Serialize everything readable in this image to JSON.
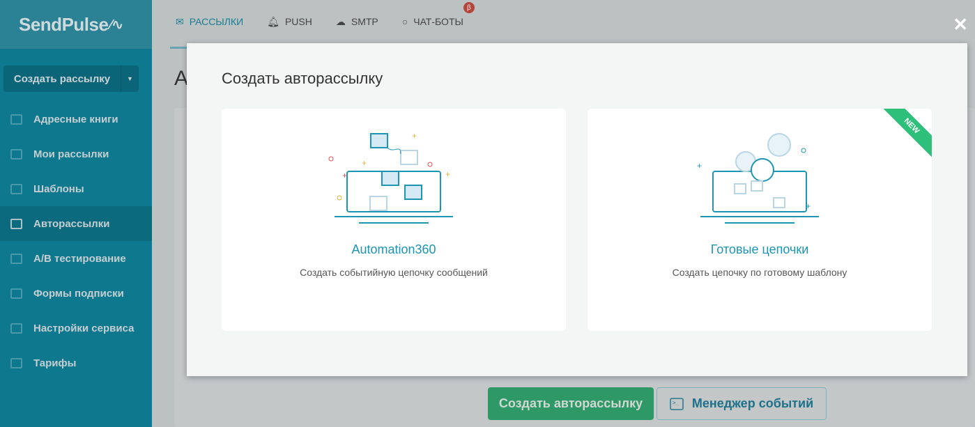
{
  "logo": "SendPulse",
  "sidebar": {
    "create_button": "Создать рассылку",
    "items": [
      {
        "label": "Адресные книги"
      },
      {
        "label": "Мои рассылки"
      },
      {
        "label": "Шаблоны"
      },
      {
        "label": "Авторассылки",
        "active": true
      },
      {
        "label": "A/B тестирование"
      },
      {
        "label": "Формы подписки"
      },
      {
        "label": "Настройки сервиса"
      },
      {
        "label": "Тарифы"
      }
    ]
  },
  "topnav": {
    "tabs": [
      {
        "label": "РАССЫЛКИ",
        "icon": "mail-icon"
      },
      {
        "label": "PUSH",
        "icon": "bell-icon"
      },
      {
        "label": "SMTP",
        "icon": "cloud-upload-icon"
      },
      {
        "label": "ЧАТ-БОТЫ",
        "icon": "chat-icon",
        "badge": "β"
      }
    ]
  },
  "background": {
    "title_fragment": "А",
    "create_button": "Создать авторассылку",
    "event_manager_button": "Менеджер событий"
  },
  "modal": {
    "title": "Создать авторассылку",
    "close": "✕",
    "cards": [
      {
        "title": "Automation360",
        "description": "Создать событийную цепочку сообщений"
      },
      {
        "title": "Готовые цепочки",
        "description": "Создать цепочку по готовому шаблону",
        "ribbon": "NEW"
      }
    ]
  },
  "colors": {
    "accent": "#1c95b5",
    "green": "#2e9966",
    "new": "#2ec07a"
  }
}
